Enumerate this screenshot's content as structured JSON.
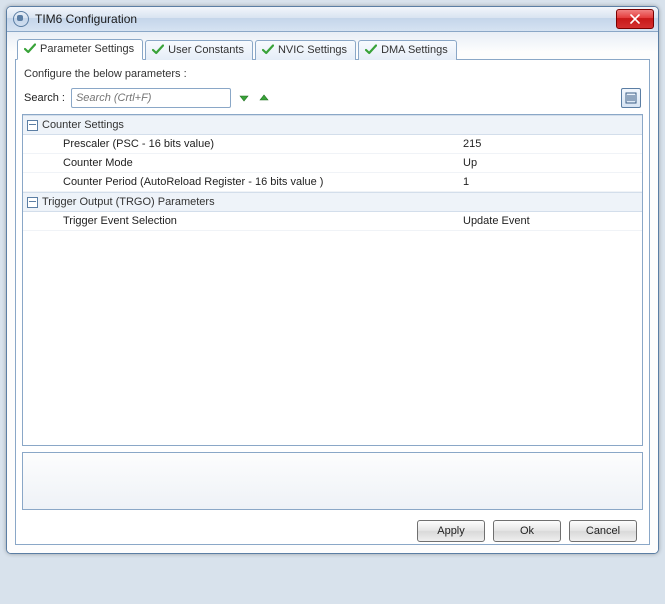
{
  "window": {
    "title": "TIM6 Configuration"
  },
  "tabs": [
    {
      "label": "Parameter Settings"
    },
    {
      "label": "User Constants"
    },
    {
      "label": "NVIC Settings"
    },
    {
      "label": "DMA Settings"
    }
  ],
  "hint": "Configure the below parameters :",
  "search": {
    "label": "Search :",
    "placeholder": "Search (Crtl+F)"
  },
  "groups": [
    {
      "title": "Counter Settings",
      "rows": [
        {
          "label": "Prescaler (PSC - 16 bits value)",
          "value": "215"
        },
        {
          "label": "Counter Mode",
          "value": "Up"
        },
        {
          "label": "Counter Period (AutoReload Register - 16 bits value )",
          "value": "1"
        }
      ]
    },
    {
      "title": "Trigger Output (TRGO) Parameters",
      "rows": [
        {
          "label": "Trigger Event Selection",
          "value": "Update Event"
        }
      ]
    }
  ],
  "buttons": {
    "apply": "Apply",
    "ok": "Ok",
    "cancel": "Cancel"
  }
}
